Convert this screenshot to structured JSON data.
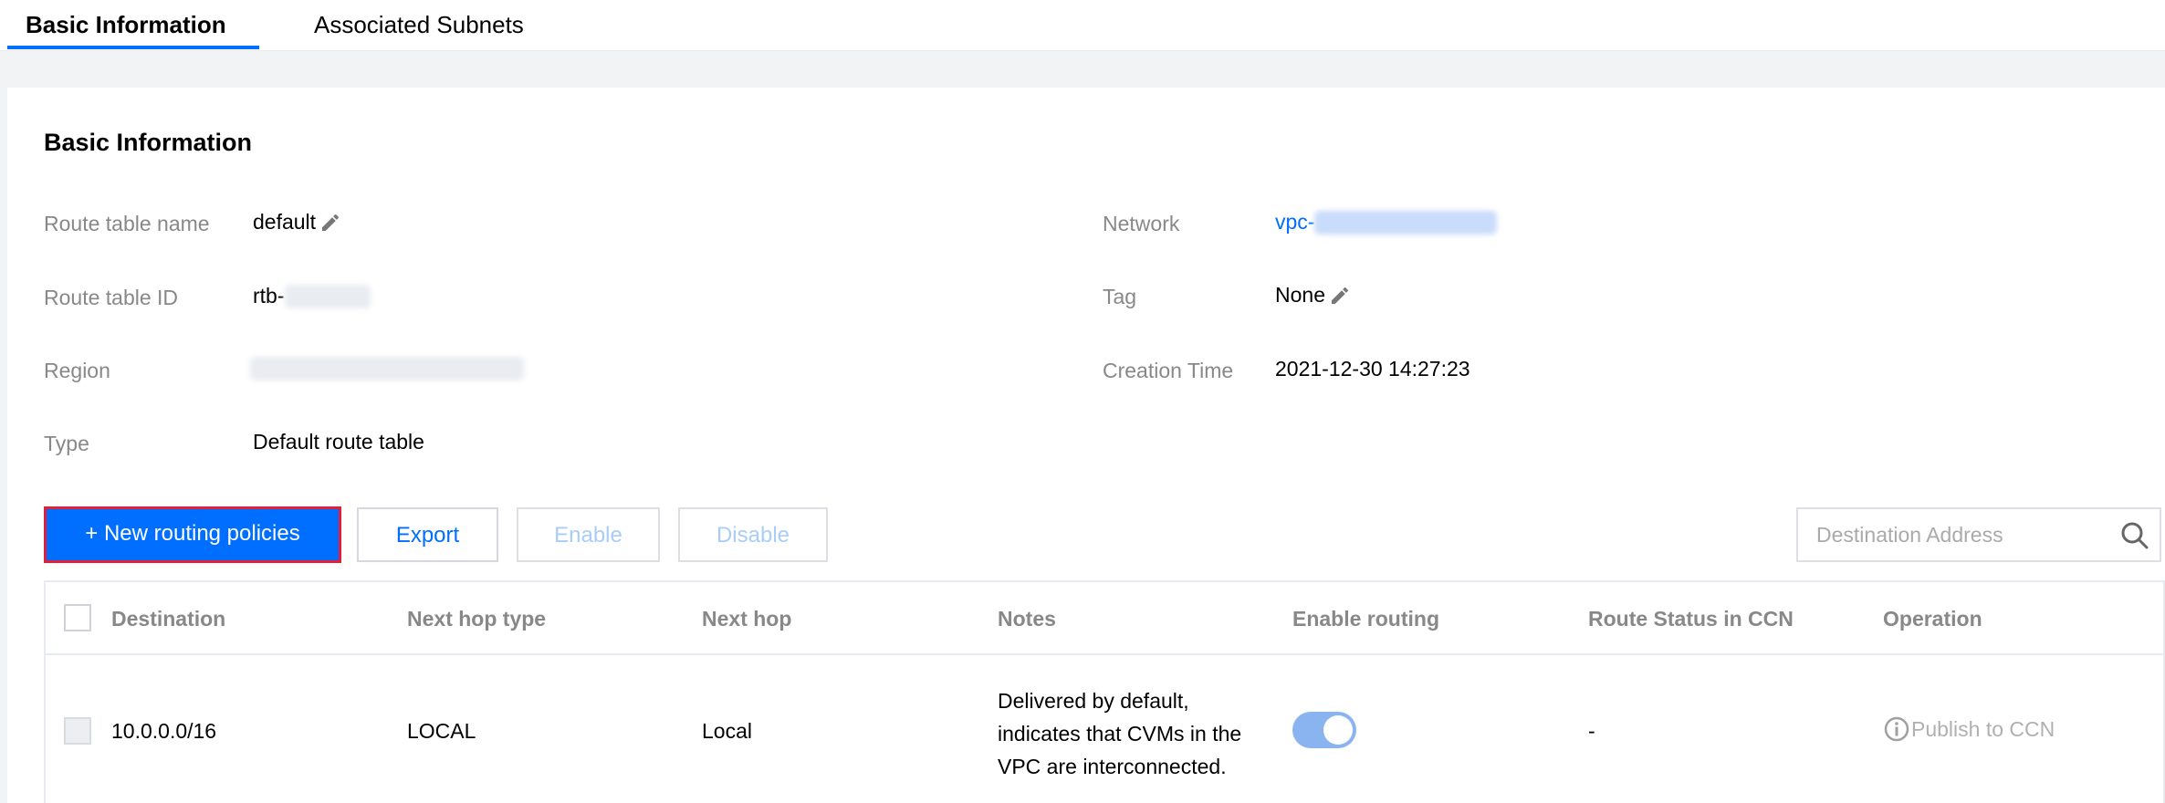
{
  "tabs": [
    {
      "label": "Basic Information",
      "active": true
    },
    {
      "label": "Associated Subnets",
      "active": false
    }
  ],
  "section": {
    "title": "Basic Information"
  },
  "info": {
    "route_table_name": {
      "label": "Route table name",
      "value": "default"
    },
    "route_table_id": {
      "label": "Route table ID",
      "value": "rtb-"
    },
    "region": {
      "label": "Region",
      "value": ""
    },
    "type": {
      "label": "Type",
      "value": "Default route table"
    },
    "network": {
      "label": "Network",
      "value": "vpc-"
    },
    "tag": {
      "label": "Tag",
      "value": "None"
    },
    "creation_time": {
      "label": "Creation Time",
      "value": "2021-12-30 14:27:23"
    }
  },
  "toolbar": {
    "new_label": "+ New routing policies",
    "export_label": "Export",
    "enable_label": "Enable",
    "disable_label": "Disable",
    "search_placeholder": "Destination Address"
  },
  "table": {
    "columns": [
      "Destination",
      "Next hop type",
      "Next hop",
      "Notes",
      "Enable routing",
      "Route Status in CCN",
      "Operation"
    ],
    "rows": [
      {
        "destination": "10.0.0.0/16",
        "next_hop_type": "LOCAL",
        "next_hop": "Local",
        "notes": "Delivered by default, indicates that CVMs in the VPC are interconnected.",
        "enable_routing": true,
        "ccn_status": "-",
        "operation": "Publish to CCN"
      }
    ]
  },
  "colors": {
    "accent": "#006eff",
    "primary_border": "#e0203a",
    "label_gray": "#888888"
  }
}
